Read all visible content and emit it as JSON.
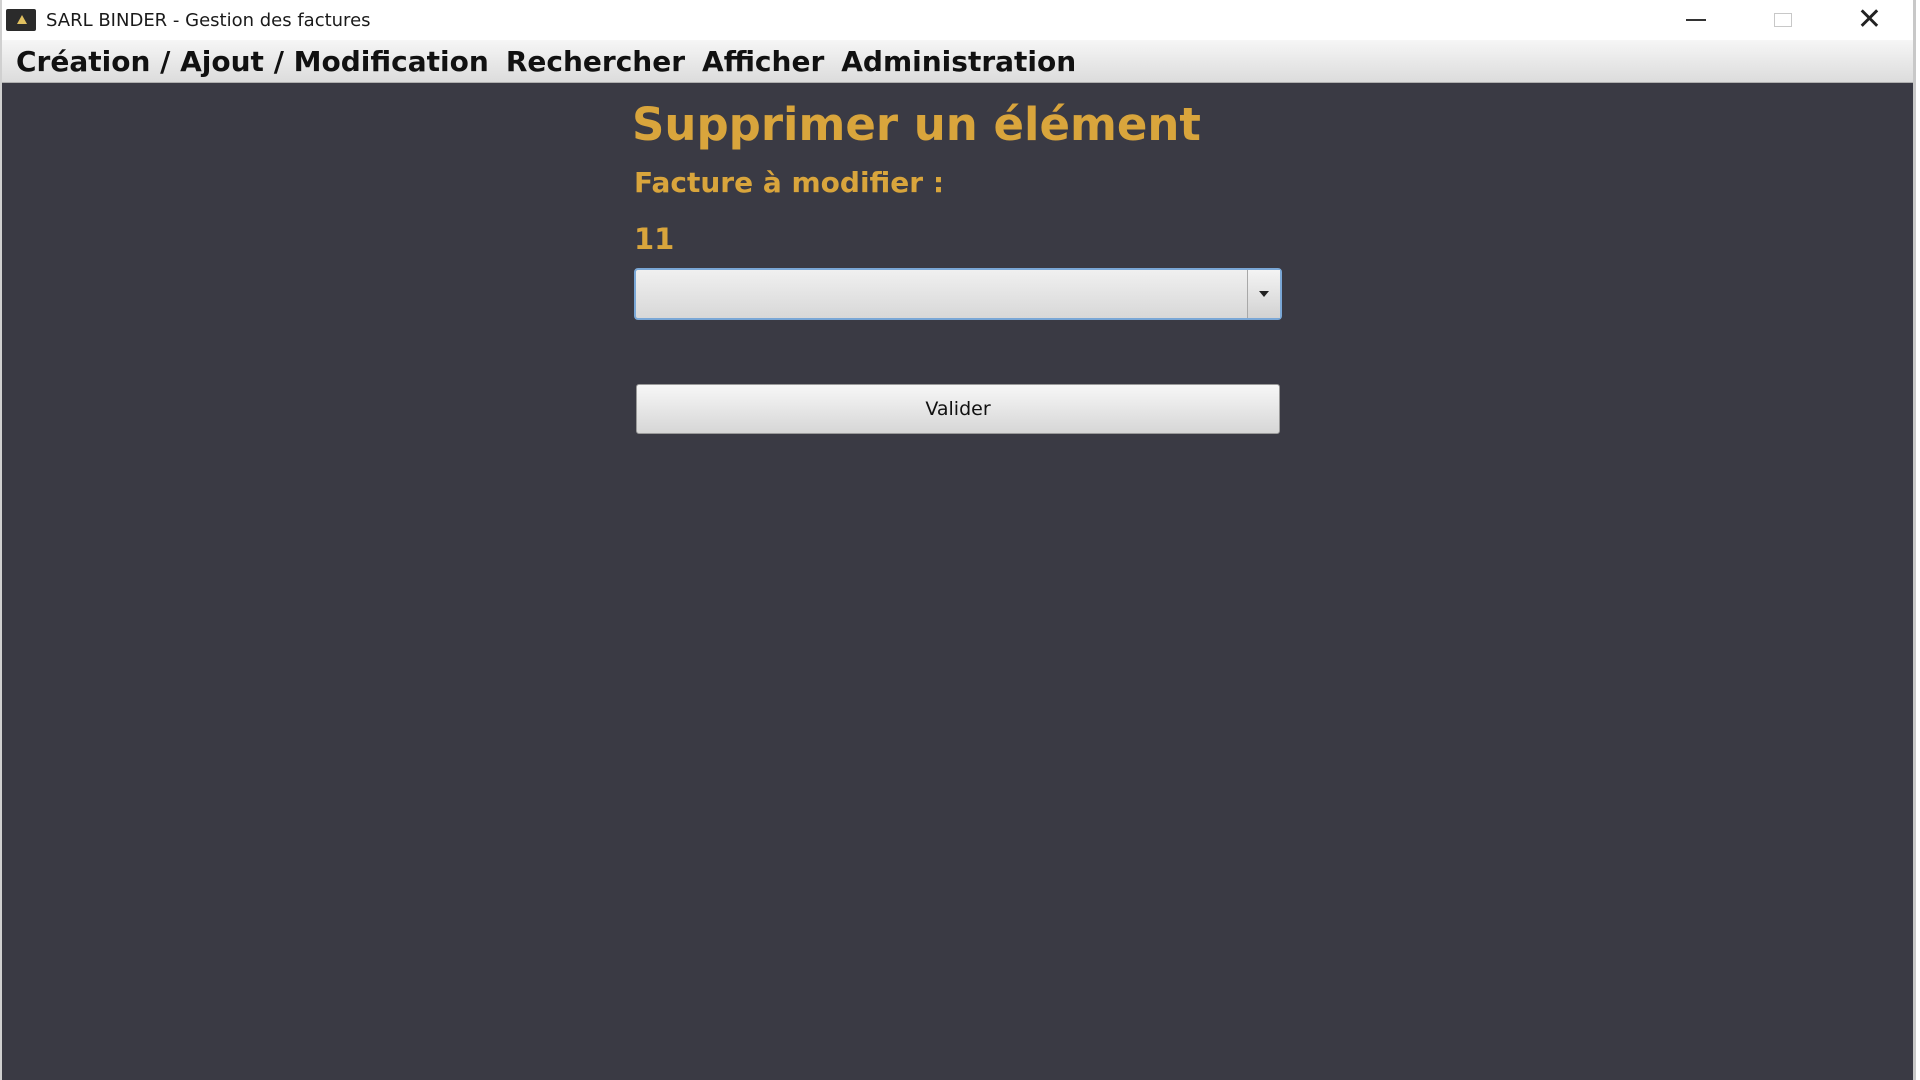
{
  "window": {
    "title": "SARL BINDER - Gestion des factures"
  },
  "menu": {
    "items": [
      {
        "label": "Création / Ajout / Modification"
      },
      {
        "label": "Rechercher"
      },
      {
        "label": "Afficher"
      },
      {
        "label": "Administration"
      }
    ]
  },
  "form": {
    "heading": "Supprimer un élément",
    "invoice_label": "Facture à modifier :",
    "invoice_value": "11",
    "combo_selected": "",
    "validate_label": "Valider"
  },
  "colors": {
    "background": "#3a3a44",
    "accent": "#d9a53c"
  },
  "icons": {
    "app": "app-icon",
    "minimize": "minimize-icon",
    "maximize": "maximize-icon",
    "close": "close-icon",
    "dropdown": "chevron-down-icon"
  }
}
